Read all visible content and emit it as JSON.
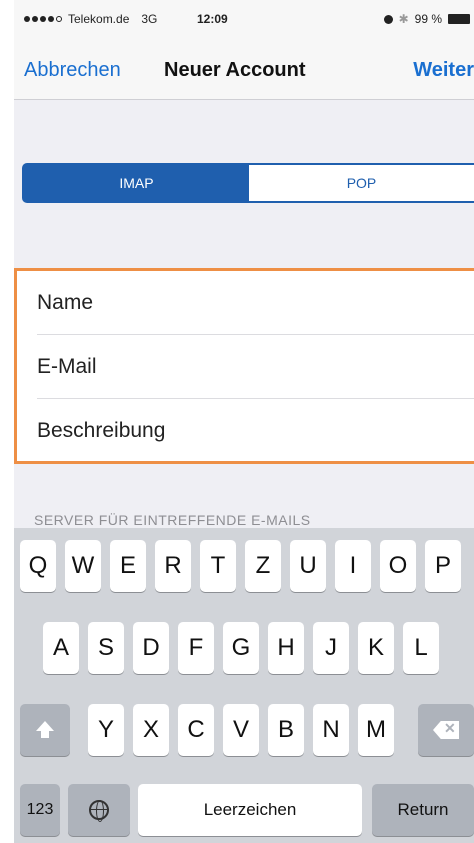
{
  "status_bar": {
    "carrier": "Telekom.de",
    "network": "3G",
    "time": "12:09",
    "bluetooth_icon": "bluetooth-icon",
    "battery": "99 %"
  },
  "nav": {
    "cancel_label": "Abbrechen",
    "title": "Neuer Account",
    "next_label": "Weiter"
  },
  "segmented": {
    "options": [
      "IMAP",
      "POP"
    ],
    "selected": "IMAP"
  },
  "form": {
    "fields": [
      {
        "placeholder": "Name"
      },
      {
        "placeholder": "E-Mail"
      },
      {
        "placeholder": "Beschreibung"
      }
    ],
    "highlight_color": "#ee8f45"
  },
  "section_header": "SERVER FÜR EINTREFFENDE E-MAILS",
  "keyboard": {
    "row1": [
      "Q",
      "W",
      "E",
      "R",
      "T",
      "Z",
      "U",
      "I",
      "O",
      "P"
    ],
    "row2": [
      "A",
      "S",
      "D",
      "F",
      "G",
      "H",
      "J",
      "K",
      "L"
    ],
    "row3": [
      "Y",
      "X",
      "C",
      "V",
      "B",
      "N",
      "M"
    ],
    "numbers_label": "123",
    "space_label": "Leerzeichen",
    "return_label": "Return"
  },
  "colors": {
    "accent": "#1a6fd0",
    "segment": "#1f5fae"
  }
}
